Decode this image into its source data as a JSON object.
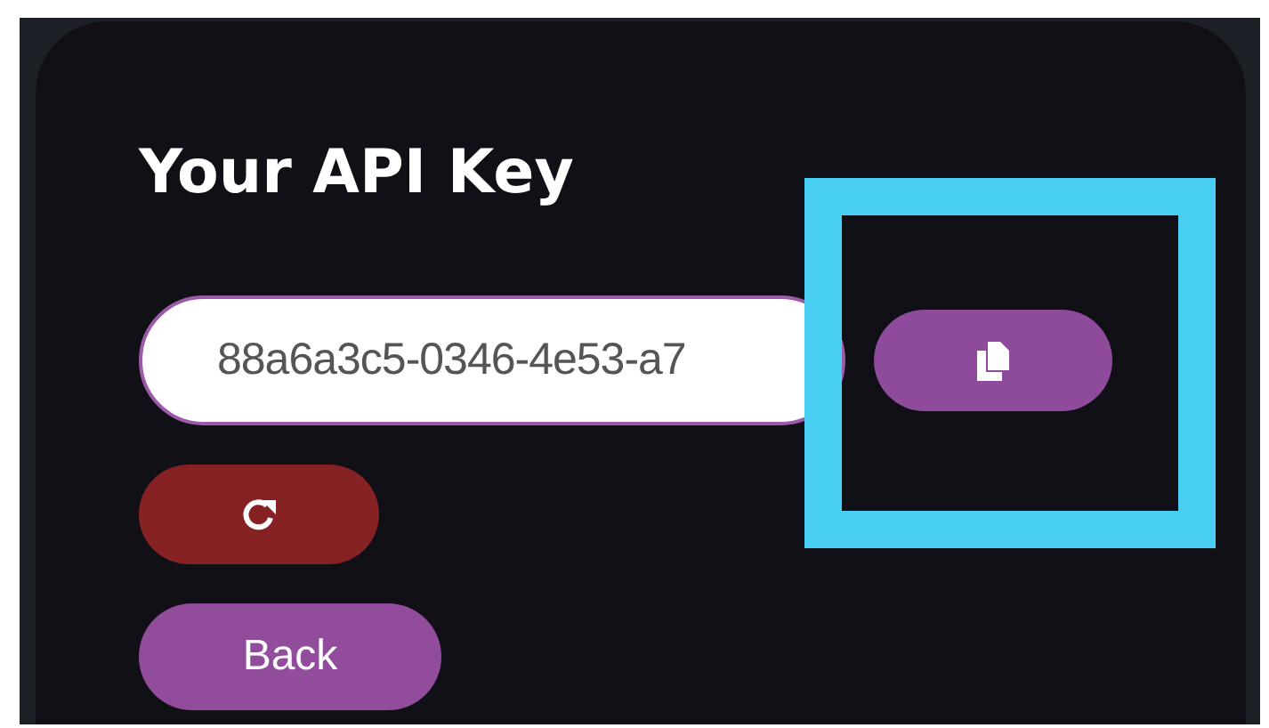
{
  "heading": "Your API Key",
  "api_key_field": {
    "value": "88a6a3c5-0346-4e53-a7"
  },
  "buttons": [
    {
      "kind": "copy"
    },
    {
      "kind": "refresh"
    },
    {
      "kind": "text",
      "label": "Back"
    }
  ]
}
